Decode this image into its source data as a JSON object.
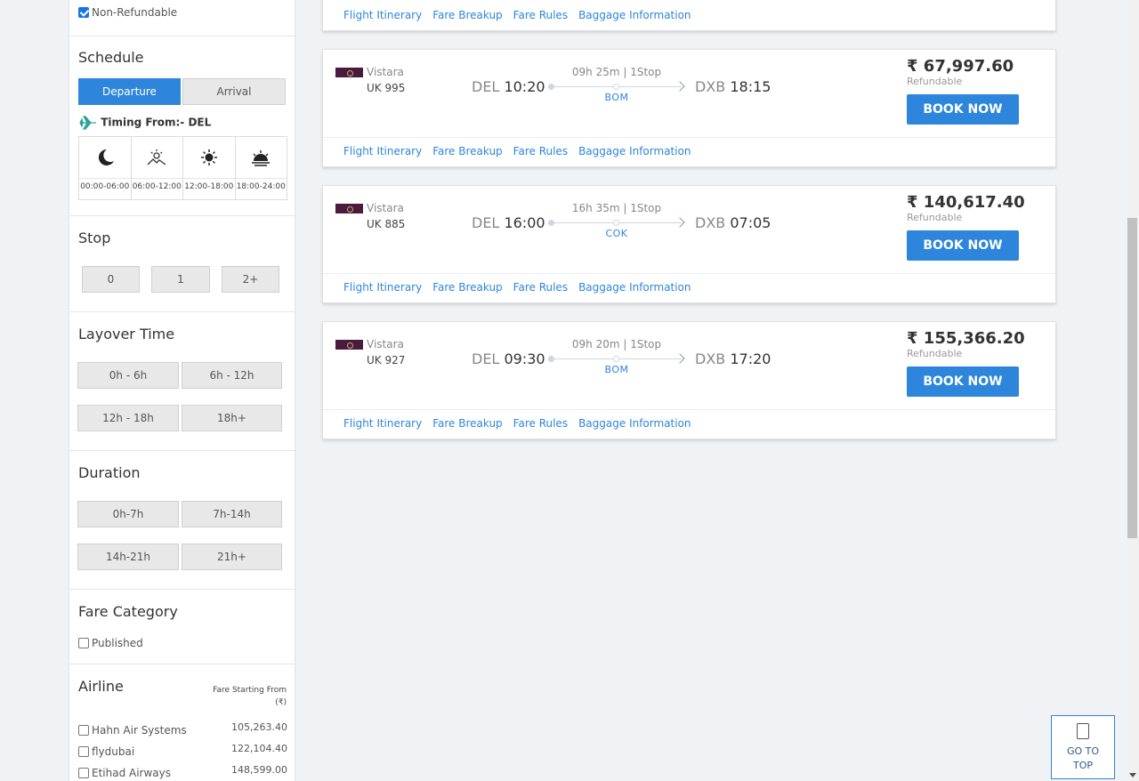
{
  "filters": {
    "non_refundable_label": "Non-Refundable",
    "schedule": {
      "title": "Schedule",
      "tabs": [
        "Departure",
        "Arrival"
      ],
      "timing_label": "Timing From:- DEL",
      "slots": [
        "00:00-06:00",
        "06:00-12:00",
        "12:00-18:00",
        "18:00-24:00"
      ]
    },
    "stop": {
      "title": "Stop",
      "options": [
        "0",
        "1",
        "2+"
      ]
    },
    "layover": {
      "title": "Layover Time",
      "options": [
        "0h - 6h",
        "6h - 12h",
        "12h - 18h",
        "18h+"
      ]
    },
    "duration": {
      "title": "Duration",
      "options": [
        "0h-7h",
        "7h-14h",
        "14h-21h",
        "21h+"
      ]
    },
    "fare_category": {
      "title": "Fare Category",
      "published_label": "Published"
    },
    "airline": {
      "title": "Airline",
      "fare_header": "Fare Starting From (₹)",
      "items": [
        {
          "name": "Hahn Air Systems",
          "fare": "105,263.40"
        },
        {
          "name": "flydubai",
          "fare": "122,104.40"
        },
        {
          "name": "Etihad Airways",
          "fare": "148,599.00"
        }
      ]
    }
  },
  "links": [
    "Flight Itinerary",
    "Fare Breakup",
    "Fare Rules",
    "Baggage Information"
  ],
  "flights": [
    {
      "airline": "Vistara",
      "flight_no": "UK  995",
      "dep_code": "DEL",
      "dep_time": "10:20",
      "duration": "09h 25m | 1Stop",
      "via": "BOM",
      "arr_code": "DXB",
      "arr_time": "18:15",
      "price": "₹ 67,997.60",
      "refund": "Refundable",
      "book": "BOOK NOW"
    },
    {
      "airline": "Vistara",
      "flight_no": "UK  885",
      "dep_code": "DEL",
      "dep_time": "16:00",
      "duration": "16h 35m | 1Stop",
      "via": "COK",
      "arr_code": "DXB",
      "arr_time": "07:05",
      "price": "₹ 140,617.40",
      "refund": "Refundable",
      "book": "BOOK NOW"
    },
    {
      "airline": "Vistara",
      "flight_no": "UK  927",
      "dep_code": "DEL",
      "dep_time": "09:30",
      "duration": "09h 20m | 1Stop",
      "via": "BOM",
      "arr_code": "DXB",
      "arr_time": "17:20",
      "price": "₹ 155,366.20",
      "refund": "Refundable",
      "book": "BOOK NOW"
    }
  ],
  "go_to_top": "GO TO TOP"
}
